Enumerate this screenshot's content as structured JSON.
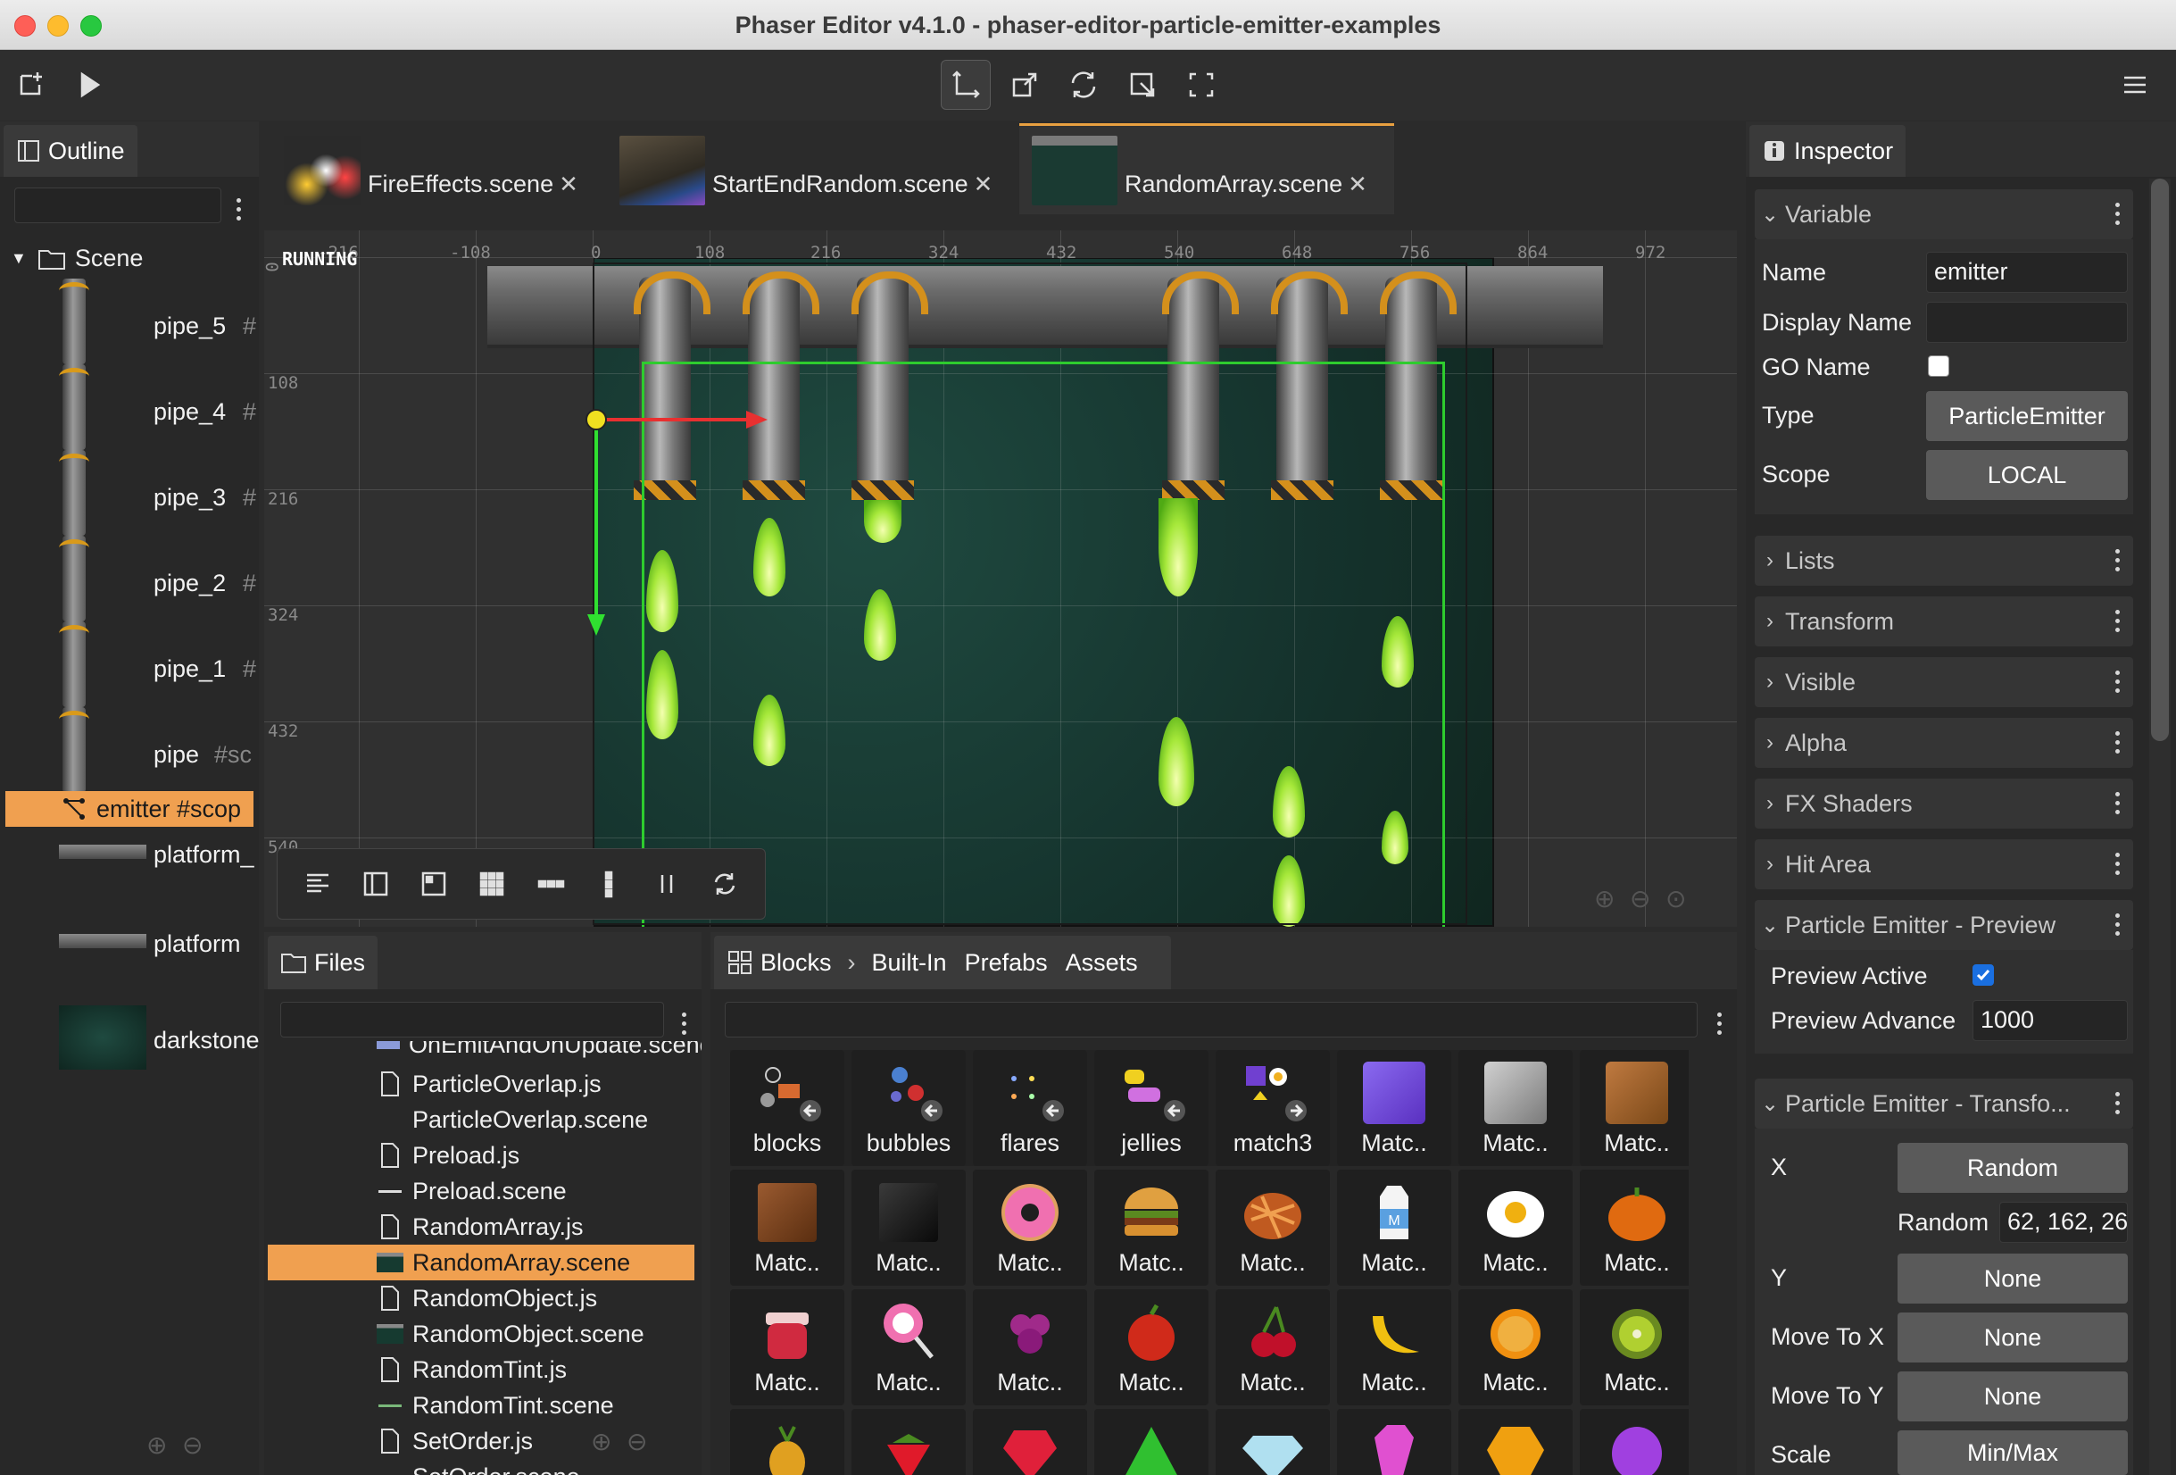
{
  "window": {
    "title": "Phaser Editor v4.1.0 - phaser-editor-particle-emitter-examples"
  },
  "outline": {
    "tab_label": "Outline",
    "root_label": "Scene",
    "items": [
      {
        "label": "pipe_5",
        "suffix": "#"
      },
      {
        "label": "pipe_4",
        "suffix": "#"
      },
      {
        "label": "pipe_3",
        "suffix": "#"
      },
      {
        "label": "pipe_2",
        "suffix": "#"
      },
      {
        "label": "pipe_1",
        "suffix": "#"
      },
      {
        "label": "pipe",
        "suffix": "#sc"
      },
      {
        "label": "emitter #scop"
      },
      {
        "label": "platform_"
      },
      {
        "label": "platform"
      },
      {
        "label": "darkstone"
      }
    ]
  },
  "editor": {
    "tabs": [
      {
        "label": "FireEffects.scene"
      },
      {
        "label": "StartEndRandom.scene"
      },
      {
        "label": "RandomArray.scene"
      }
    ],
    "status": "RUNNING",
    "ruler_x": [
      "-216",
      "-108",
      "0",
      "108",
      "216",
      "324",
      "432",
      "540",
      "648",
      "756",
      "864",
      "972"
    ],
    "ruler_y": [
      "0",
      "108",
      "216",
      "324",
      "432",
      "540"
    ]
  },
  "files": {
    "tab_label": "Files",
    "items": [
      {
        "label": "OnEmitAndOnUpdate.scene"
      },
      {
        "label": "ParticleOverlap.js"
      },
      {
        "label": "ParticleOverlap.scene"
      },
      {
        "label": "Preload.js"
      },
      {
        "label": "Preload.scene"
      },
      {
        "label": "RandomArray.js"
      },
      {
        "label": "RandomArray.scene"
      },
      {
        "label": "RandomObject.js"
      },
      {
        "label": "RandomObject.scene"
      },
      {
        "label": "RandomTint.js"
      },
      {
        "label": "RandomTint.scene"
      },
      {
        "label": "SetOrder.js"
      },
      {
        "label": "SetOrder.scene"
      }
    ]
  },
  "blocks": {
    "tab_label": "Blocks",
    "crumbs": [
      "Built-In",
      "Prefabs",
      "Assets"
    ],
    "row1": [
      {
        "label": "blocks"
      },
      {
        "label": "bubbles"
      },
      {
        "label": "flares"
      },
      {
        "label": "jellies"
      },
      {
        "label": "match3"
      },
      {
        "label": "Matc.."
      },
      {
        "label": "Matc.."
      },
      {
        "label": "Matc.."
      }
    ],
    "row2": [
      {
        "label": "Matc.."
      },
      {
        "label": "Matc.."
      },
      {
        "label": "Matc.."
      },
      {
        "label": "Matc.."
      },
      {
        "label": "Matc.."
      },
      {
        "label": "Matc.."
      },
      {
        "label": "Matc.."
      },
      {
        "label": "Matc.."
      }
    ],
    "row3": [
      {
        "label": "Matc.."
      },
      {
        "label": "Matc.."
      },
      {
        "label": "Matc.."
      },
      {
        "label": "Matc.."
      },
      {
        "label": "Matc.."
      },
      {
        "label": "Matc.."
      },
      {
        "label": "Matc.."
      },
      {
        "label": "Matc.."
      }
    ]
  },
  "inspector": {
    "tab_label": "Inspector",
    "variable": {
      "title": "Variable",
      "name_label": "Name",
      "name_value": "emitter",
      "display_name_label": "Display Name",
      "display_name_value": "",
      "go_name_label": "GO Name",
      "type_label": "Type",
      "type_value": "ParticleEmitter",
      "scope_label": "Scope",
      "scope_value": "LOCAL"
    },
    "sections": [
      "Lists",
      "Transform",
      "Visible",
      "Alpha",
      "FX Shaders",
      "Hit Area"
    ],
    "preview": {
      "title": "Particle Emitter - Preview",
      "active_label": "Preview Active",
      "active_checked": true,
      "advance_label": "Preview Advance",
      "advance_value": "1000"
    },
    "transform": {
      "title": "Particle Emitter - Transfo...",
      "x_label": "X",
      "x_value": "Random",
      "random_label": "Random",
      "random_value": "62, 162, 26",
      "y_label": "Y",
      "y_value": "None",
      "move_x_label": "Move To X",
      "move_x_value": "None",
      "move_y_label": "Move To Y",
      "move_y_value": "None",
      "scale_label": "Scale",
      "scale_value": "Min/Max"
    }
  },
  "colors": {
    "accent": "#f0a050",
    "selection_green": "#2ecc2e",
    "panel_bg": "#2f2f2f"
  }
}
